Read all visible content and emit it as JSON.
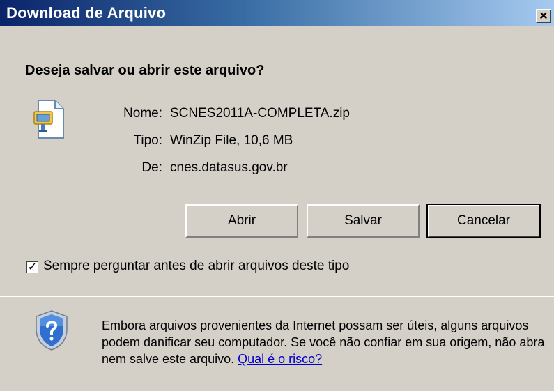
{
  "window": {
    "title": "Download de Arquivo",
    "close_glyph": "×"
  },
  "dialog": {
    "question": "Deseja salvar ou abrir este arquivo?",
    "file_icon": "zip-file-icon",
    "fields": [
      {
        "label": "Nome:",
        "value": "SCNES2011A-COMPLETA.zip"
      },
      {
        "label": "Tipo:",
        "value": "WinZip File, 10,6 MB"
      },
      {
        "label": "De:",
        "value": "cnes.datasus.gov.br"
      }
    ],
    "buttons": {
      "open": "Abrir",
      "save": "Salvar",
      "cancel": "Cancelar"
    },
    "checkbox": {
      "label": "Sempre perguntar antes de abrir arquivos deste tipo",
      "checked": true
    },
    "warning": {
      "icon": "shield-question-icon",
      "text": "Embora arquivos provenientes da Internet possam ser úteis, alguns arquivos podem danificar seu computador. Se você não confiar em sua origem, não abra nem salve este arquivo. ",
      "link": "Qual é o risco?"
    }
  },
  "colors": {
    "titlebar_start": "#0a246a",
    "titlebar_end": "#a6caf0",
    "dialog_bg": "#d4d0c8",
    "link": "#0000cc"
  }
}
